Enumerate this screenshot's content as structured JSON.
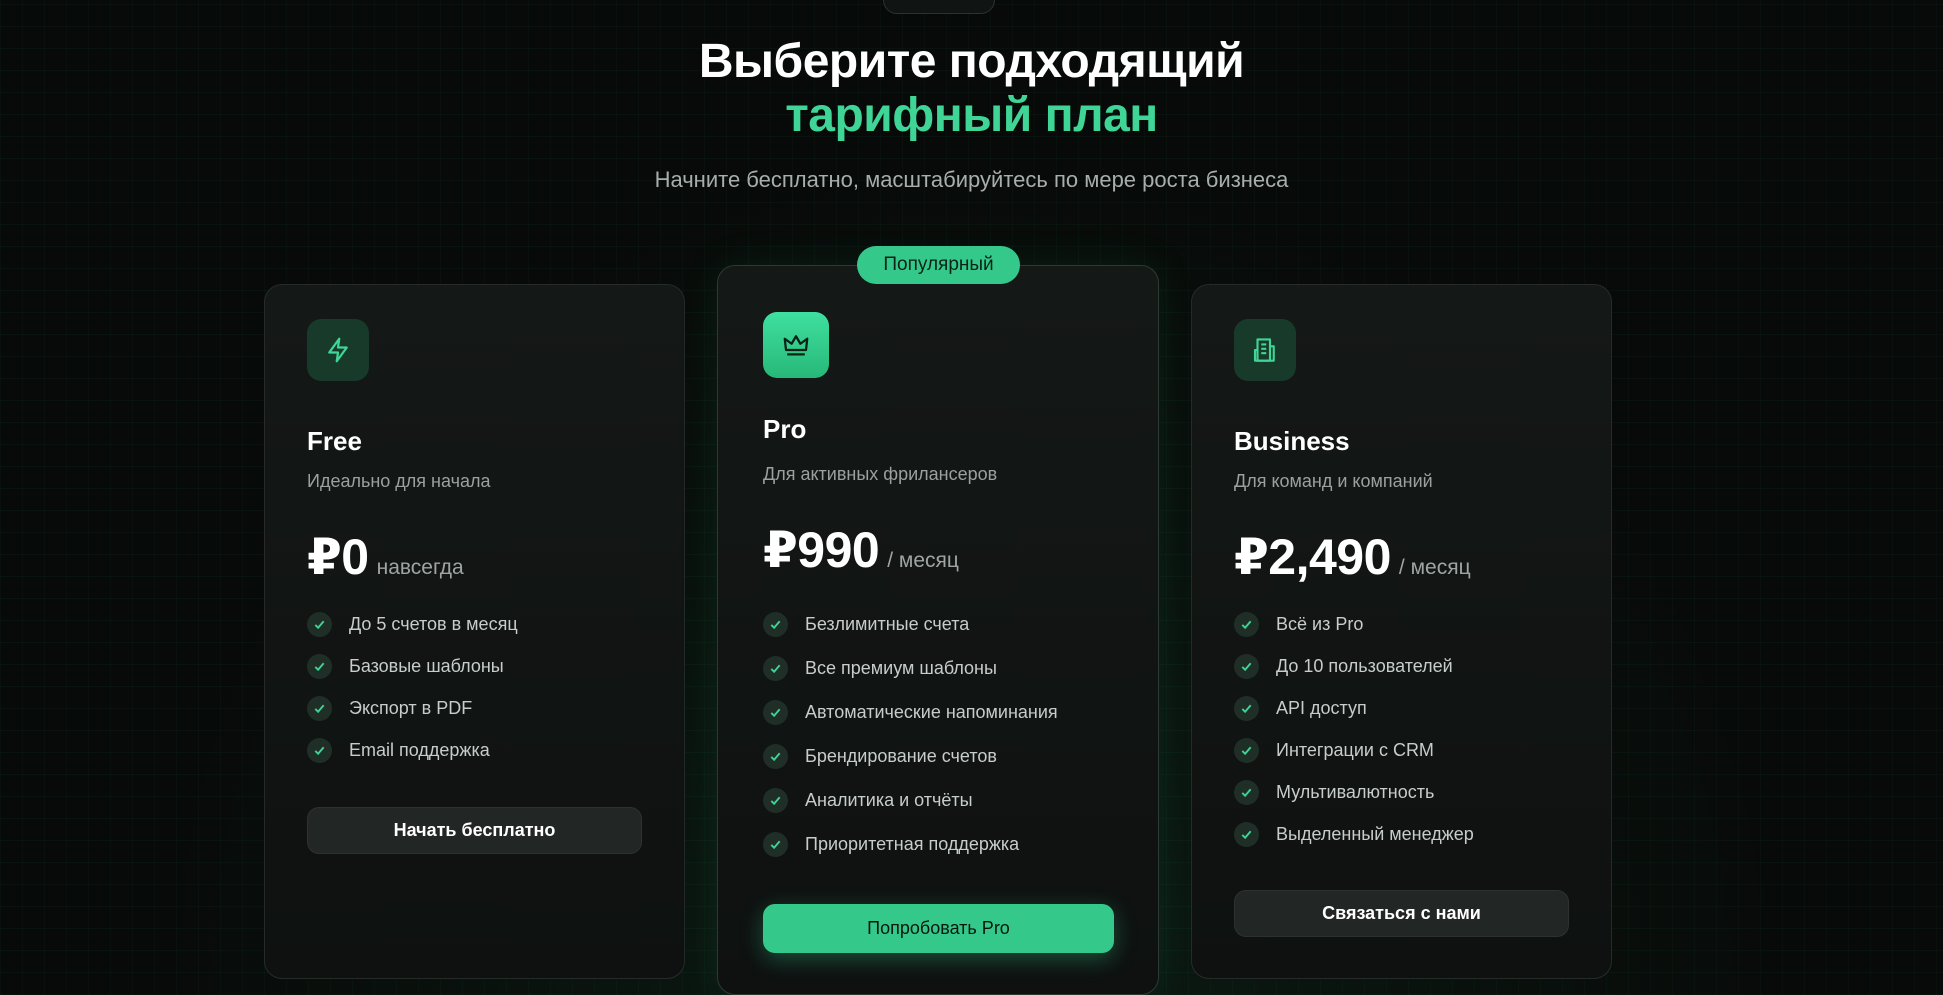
{
  "header": {
    "title_line1": "Выберите подходящий",
    "title_line2": "тарифный план",
    "subtitle": "Начните бесплатно, масштабируйтесь по мере роста бизнеса"
  },
  "accent_color": "#34c98b",
  "plans": [
    {
      "icon": "lightning-icon",
      "name": "Free",
      "description": "Идеально для начала",
      "price": "₽0",
      "period": "навсегда",
      "features": [
        "До 5 счетов в месяц",
        "Базовые шаблоны",
        "Экспорт в PDF",
        "Email поддержка"
      ],
      "button": "Начать бесплатно"
    },
    {
      "badge": "Популярный",
      "icon": "crown-icon",
      "name": "Pro",
      "description": "Для активных фрилансеров",
      "price": "₽990",
      "period": "/ месяц",
      "features": [
        "Безлимитные счета",
        "Все премиум шаблоны",
        "Автоматические напоминания",
        "Брендирование счетов",
        "Аналитика и отчёты",
        "Приоритетная поддержка"
      ],
      "button": "Попробовать Pro"
    },
    {
      "icon": "building-icon",
      "name": "Business",
      "description": "Для команд и компаний",
      "price": "₽2,490",
      "period": "/ месяц",
      "features": [
        "Всё из Pro",
        "До 10 пользователей",
        "API доступ",
        "Интеграции с CRM",
        "Мультивалютность",
        "Выделенный менеджер"
      ],
      "button": "Связаться с нами"
    }
  ]
}
